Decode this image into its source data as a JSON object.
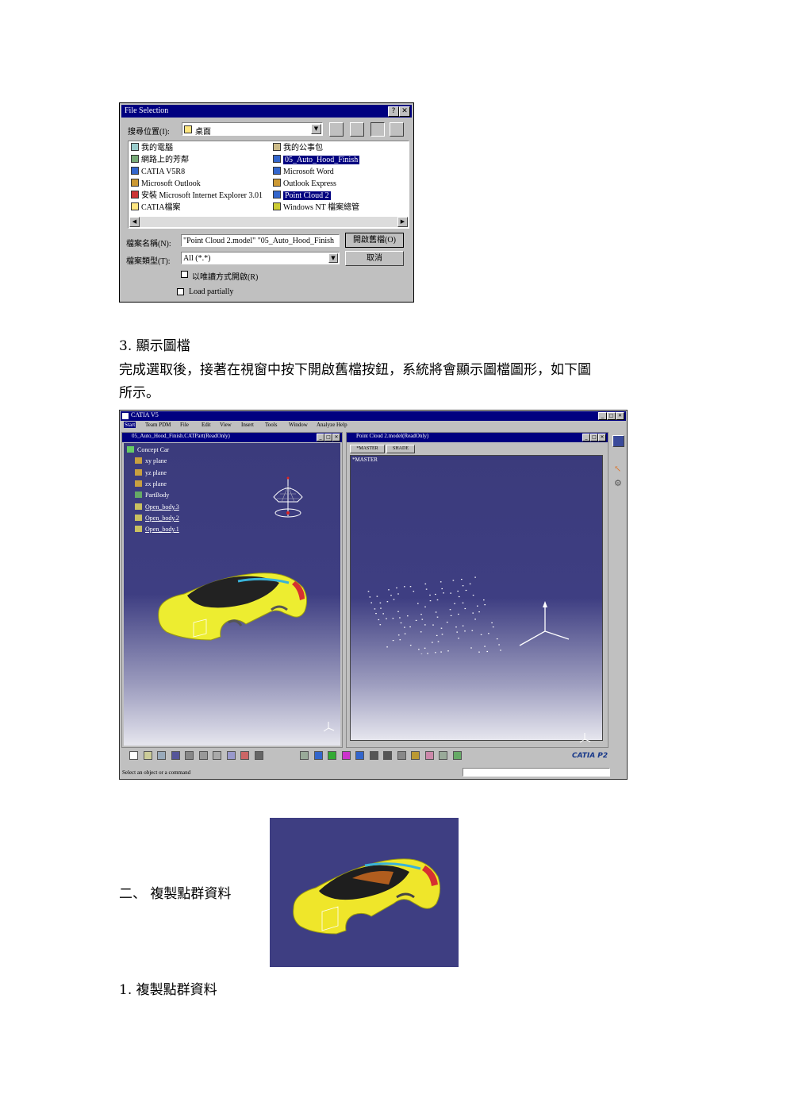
{
  "file_dialog": {
    "title": "File Selection",
    "help_btn": "?",
    "close_btn": "✕",
    "lookin_label": "搜尋位置(I):",
    "lookin_value": "桌面",
    "files_left": [
      "我的電腦",
      "網路上的芳鄰",
      "CATIA V5R8",
      "Microsoft Outlook",
      "安裝 Microsoft Internet Explorer 3.01",
      "CATIA檔案"
    ],
    "files_right": [
      "我的公事包",
      "05_Auto_Hood_Finish",
      "Microsoft Word",
      "Outlook Express",
      "Point Cloud 2",
      "Windows NT 檔案總管"
    ],
    "filename_label": "檔案名稱(N):",
    "filename_value": "\"Point Cloud 2.model\" \"05_Auto_Hood_Finish",
    "filetype_label": "檔案類型(T):",
    "filetype_value": "All (*.*)",
    "open_btn": "開啟舊檔(O)",
    "cancel_btn": "取消",
    "readonly_label": "以唯讀方式開啟(R)",
    "load_partially_label": "Load partially"
  },
  "section3": {
    "heading": "3.  顯示圖檔",
    "line1": "完成選取後，接著在視窗中按下開啟舊檔按鈕，系統將會顯示圖檔圖形，如下圖",
    "line2": "所示。"
  },
  "catia": {
    "app_title": "CATIA V5",
    "menus": [
      "Start",
      "Team PDM",
      "File",
      "Edit",
      "View",
      "Insert",
      "Tools",
      "Window",
      "Analyze",
      "Help"
    ],
    "left_title": "05_Auto_Hood_Finish.CATPart(ReadOnly)",
    "right_title": "Point Cloud 2.model(ReadOnly)",
    "tree": [
      "Concept Car",
      "xy plane",
      "yz plane",
      "zx plane",
      "PartBody",
      "Open_body.3",
      "Open_body.2",
      "Open_body.1"
    ],
    "tabs": [
      "*MASTER",
      "SHADE"
    ],
    "master_label": "*MASTER",
    "logo": "CATIA P2",
    "status": "Select an object or a command"
  },
  "section2": {
    "heading": "二、  複製點群資料"
  },
  "section1": {
    "heading": "1.  複製點群資料"
  },
  "colors": {
    "titlebar": "#000080",
    "viewport": "#3e3e82",
    "car_body": "#f2f22a"
  }
}
